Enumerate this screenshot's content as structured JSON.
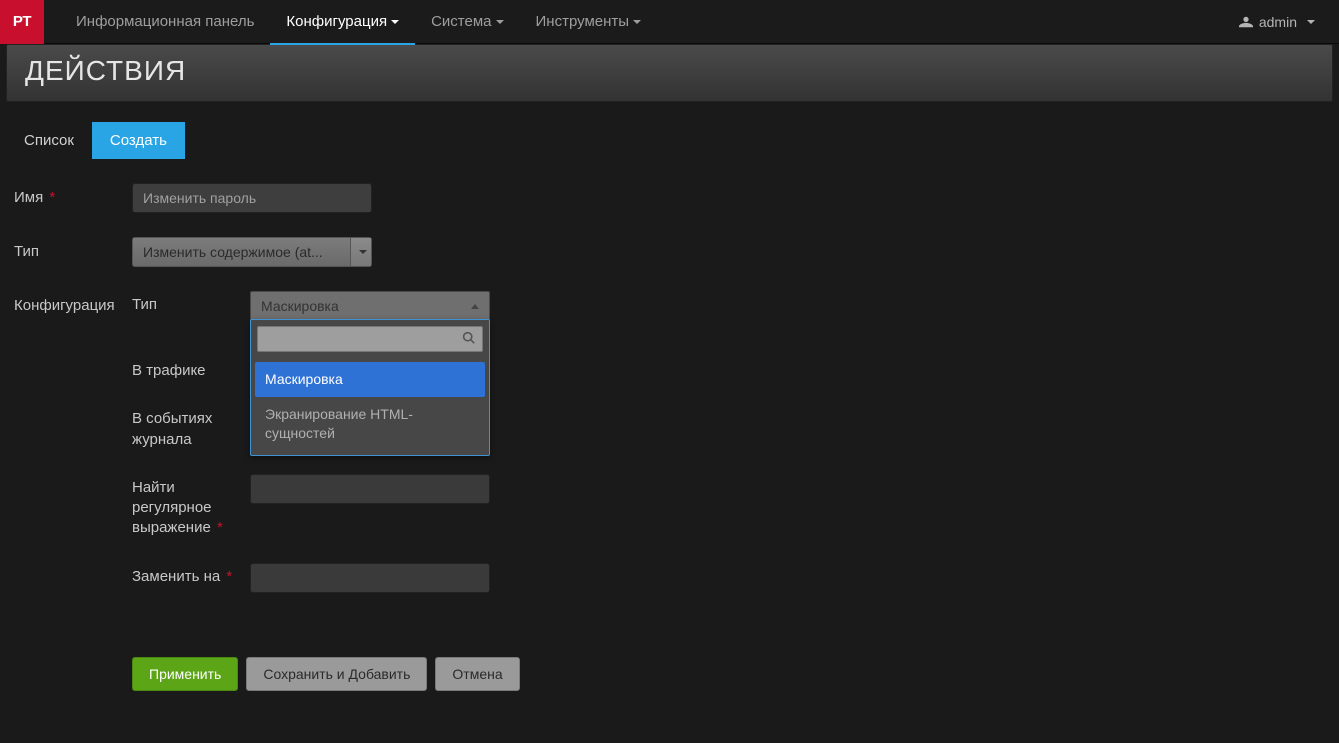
{
  "navbar": {
    "logo": "PT",
    "items": [
      {
        "label": "Информационная панель",
        "active": false,
        "dropdown": false
      },
      {
        "label": "Конфигурация",
        "active": true,
        "dropdown": true
      },
      {
        "label": "Система",
        "active": false,
        "dropdown": true
      },
      {
        "label": "Инструменты",
        "active": false,
        "dropdown": true
      }
    ],
    "user": "admin"
  },
  "page": {
    "title": "ДЕЙСТВИЯ"
  },
  "tabs": {
    "list": "Список",
    "create": "Создать"
  },
  "form": {
    "name_label": "Имя",
    "name_placeholder": "Изменить пароль",
    "type_label": "Тип",
    "type_value": "Изменить содержимое (at...",
    "config_label": "Конфигурация",
    "config": {
      "type_label": "Тип",
      "type_selected": "Маскировка",
      "type_options": [
        "Маскировка",
        "Экранирование HTML-сущностей"
      ],
      "in_traffic_label": "В трафике",
      "in_log_events_label": "В событиях журнала",
      "regex_label": "Найти регулярное выражение",
      "replace_label": "Заменить на"
    }
  },
  "buttons": {
    "apply": "Применить",
    "save_add": "Сохранить и Добавить",
    "cancel": "Отмена"
  }
}
